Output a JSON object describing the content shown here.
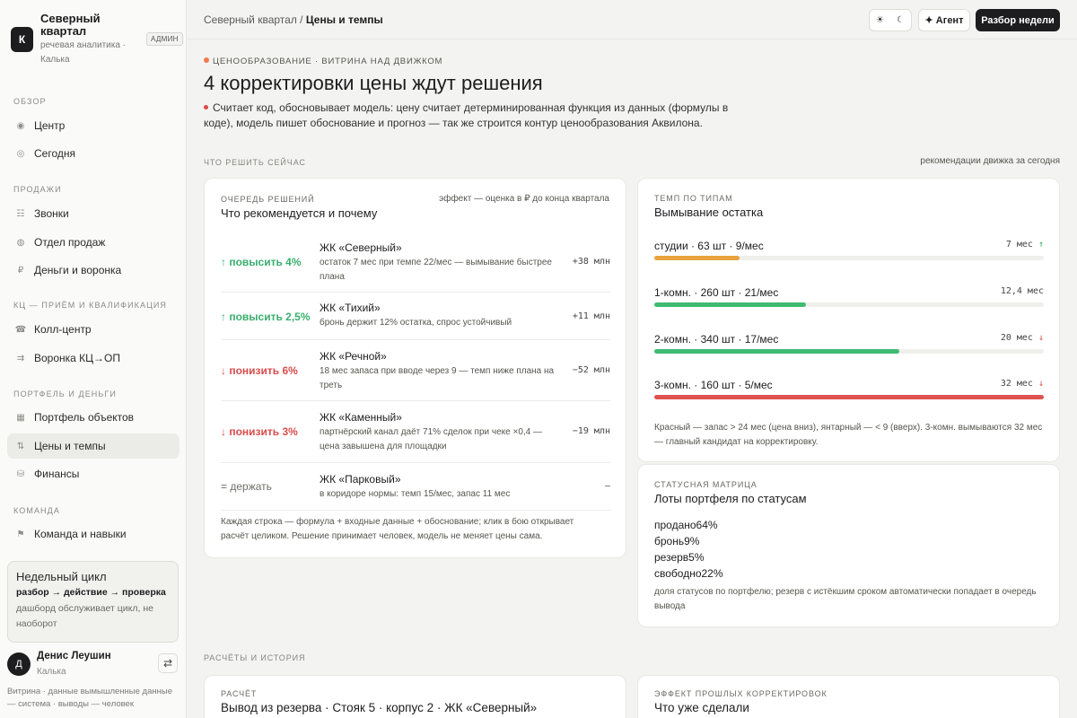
{
  "brand": {
    "logo_letter": "К",
    "title": "Северный квартал",
    "subtitle": "речевая аналитика · Калька",
    "badge": "АДМИН"
  },
  "nav": {
    "groups": [
      {
        "label": "ОБЗОР"
      },
      {
        "label": "ПРОДАЖИ"
      },
      {
        "label": "КЦ — ПРИЁМ И КВАЛИФИКАЦИЯ"
      },
      {
        "label": "ПОРТФЕЛЬ И ДЕНЬГИ"
      },
      {
        "label": "КОМАНДА"
      }
    ],
    "items": [
      {
        "label": "Центр",
        "icon": "◉"
      },
      {
        "label": "Сегодня",
        "icon": "◎"
      },
      {
        "label": "Звонки",
        "icon": "☷"
      },
      {
        "label": "Отдел продаж",
        "icon": "◍"
      },
      {
        "label": "Деньги и воронка",
        "icon": "₽"
      },
      {
        "label": "Колл-центр",
        "icon": "☎"
      },
      {
        "label": "Воронка КЦ→ОП",
        "icon": "⇉"
      },
      {
        "label": "Портфель объектов",
        "icon": "▦"
      },
      {
        "label": "Цены и темпы",
        "icon": "⇅"
      },
      {
        "label": "Финансы",
        "icon": "⛁"
      },
      {
        "label": "Команда и навыки",
        "icon": "⚑"
      }
    ]
  },
  "cycle": {
    "title": "Недельный цикл",
    "flow": "разбор → действие → проверка",
    "text": "дашборд обслуживает цикл, не наоборот"
  },
  "user": {
    "initial": "Д",
    "name": "Денис Леушин",
    "role": "Калька",
    "swap_icon": "⇄"
  },
  "footer_note": "Витрина · данные вымышленные данные — система · выводы — человек",
  "topbar": {
    "crumb_parent": "Северный квартал",
    "crumb_sep": "/",
    "crumb_current": "Цены и темпы",
    "theme_light": "☀",
    "theme_dark": "☾",
    "agent_label": "✦ Агент",
    "week_label": "Разбор недели"
  },
  "hero": {
    "eyebrow": "ЦЕНООБРАЗОВАНИЕ · ВИТРИНА НАД ДВИЖКОМ",
    "title": "4 корректировки цены ждут решения",
    "desc": "Считает код, обосновывает модель: цену считает детерминированная функция из данных (формулы в коде), модель пишет обоснование и прогноз — так же строится контур ценообразования Аквилона."
  },
  "section": {
    "decide_now": "ЧТО РЕШИТЬ СЕЙЧАС",
    "decide_right": "рекомендации движка за сегодня",
    "history": "РАСЧЁТЫ И ИСТОРИЯ"
  },
  "queue": {
    "kicker": "ОЧЕРЕДЬ РЕШЕНИЙ",
    "title": "Что рекомендуется и почему",
    "note": "эффект — оценка в ₽ до конца квартала",
    "rows": [
      {
        "action": "↑ повысить 4%",
        "dir": "up",
        "object": "ЖК «Северный»",
        "reason": "остаток 7 мес при темпе 22/мес — вымывание быстрее плана",
        "effect": "+38 млн"
      },
      {
        "action": "↑ повысить 2,5%",
        "dir": "up",
        "object": "ЖК «Тихий»",
        "reason": "бронь держит 12% остатка, спрос устойчивый",
        "effect": "+11 млн"
      },
      {
        "action": "↓ понизить 6%",
        "dir": "down",
        "object": "ЖК «Речной»",
        "reason": "18 мес запаса при вводе через 9 — темп ниже плана на треть",
        "effect": "−52 млн"
      },
      {
        "action": "↓ понизить 3%",
        "dir": "down",
        "object": "ЖК «Каменный»",
        "reason": "партнёрский канал даёт 71% сделок при чеке ×0,4 — цена завышена для площадки",
        "effect": "−19 млн"
      },
      {
        "action": "= держать",
        "dir": "hold",
        "object": "ЖК «Парковый»",
        "reason": "в коридоре нормы: темп 15/мес, запас 11 мес",
        "effect": "–"
      }
    ],
    "footer": "Каждая строка — формула + входные данные + обоснование; клик в бою открывает расчёт целиком. Решение принимает человек, модель не меняет цены сама."
  },
  "washout": {
    "kicker": "ТЕМП ПО ТИПАМ",
    "title": "Вымывание остатка",
    "rows": [
      {
        "label": "студии · 63 шт · 9/мес",
        "value": "7 мес",
        "arrow": "↑",
        "trend": "up",
        "level": 0.22,
        "color": "#e8a33d"
      },
      {
        "label": "1-комн. · 260 шт · 21/мес",
        "value": "12,4 мес",
        "arrow": "",
        "trend": "none",
        "level": 0.39,
        "color": "#3fba72"
      },
      {
        "label": "2-комн. · 340 шт · 17/мес",
        "value": "20 мес",
        "arrow": "↓",
        "trend": "down",
        "level": 0.63,
        "color": "#3fba72"
      },
      {
        "label": "3-комн. · 160 шт · 5/мес",
        "value": "32 мес",
        "arrow": "↓",
        "trend": "down",
        "level": 1.0,
        "color": "#e05252"
      }
    ],
    "note": "Красный — запас > 24 мес (цена вниз), янтарный — < 9 (вверх). 3-комн. вымываются 32 мес — главный кандидат на корректировку."
  },
  "matrix": {
    "kicker": "СТАТУСНАЯ МАТРИЦА",
    "title": "Лоты портфеля по статусам",
    "lines": [
      "продано64%",
      "бронь9%",
      "резерв5%",
      "свободно22%"
    ],
    "note": "доля статусов по портфелю; резерв с истёкшим сроком автоматически попадает в очередь вывода"
  },
  "calc": {
    "kicker": "РАСЧЁТ",
    "title": "Вывод из резерва · Стояк 5 · корпус 2 · ЖК «Северный»"
  },
  "past": {
    "kicker": "ЭФФЕКТ ПРОШЛЫХ КОРРЕКТИРОВОК",
    "title": "Что уже сделали"
  }
}
